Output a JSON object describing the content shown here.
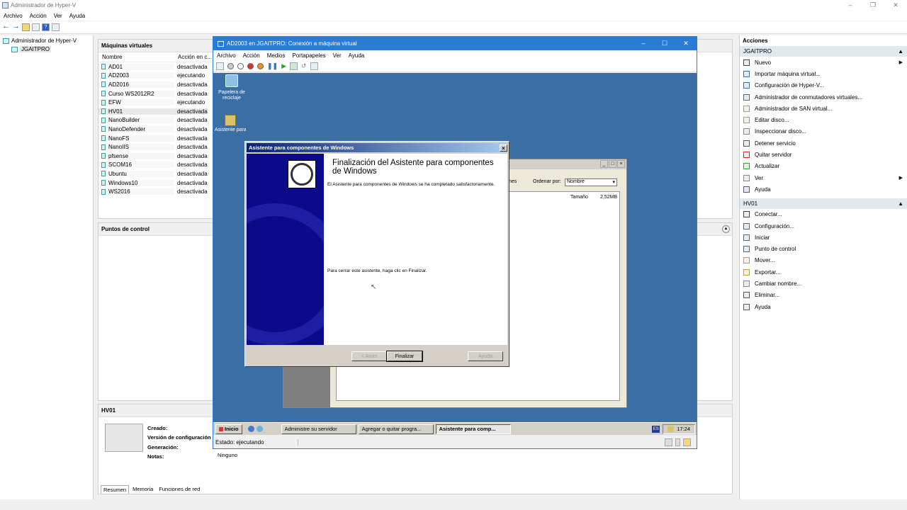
{
  "app": {
    "title": "Administrador de Hyper-V"
  },
  "menu": [
    "Archivo",
    "Acción",
    "Ver",
    "Ayuda"
  ],
  "tree": {
    "root": "Administrador de Hyper-V",
    "server": "JGAITPRO"
  },
  "vms": {
    "title": "Máquinas virtuales",
    "col_name": "Nombre",
    "col_state": "Acción en c...",
    "rows": [
      {
        "name": "AD01",
        "state": "desactivada"
      },
      {
        "name": "AD2003",
        "state": "ejecutando"
      },
      {
        "name": "AD2016",
        "state": "desactivada"
      },
      {
        "name": "Curso WS2012R2",
        "state": "desactivada"
      },
      {
        "name": "EFW",
        "state": "ejecutando"
      },
      {
        "name": "HV01",
        "state": "desactivada"
      },
      {
        "name": "NanoBuilder",
        "state": "desactivada"
      },
      {
        "name": "NanoDefender",
        "state": "desactivada"
      },
      {
        "name": "NanoFS",
        "state": "desactivada"
      },
      {
        "name": "NanoIIS",
        "state": "desactivada"
      },
      {
        "name": "pfsense",
        "state": "desactivada"
      },
      {
        "name": "SCOM16",
        "state": "desactivada"
      },
      {
        "name": "Ubuntu",
        "state": "desactivada"
      },
      {
        "name": "Windows10",
        "state": "desactivada"
      },
      {
        "name": "WS2016",
        "state": "desactivada"
      }
    ]
  },
  "checkpoints": {
    "title": "Puntos de control"
  },
  "details": {
    "title": "HV01",
    "created": "Creado:",
    "version": "Versión de configuración",
    "generation": "Generación:",
    "notes": "Notas:",
    "notes_value": "Ninguno",
    "tabs": [
      "Resumen",
      "Memoria",
      "Funciones de red"
    ]
  },
  "actions": {
    "title": "Acciones",
    "server_group": "JGAITPRO",
    "server_items": [
      "Nuevo",
      "Importar máquina virtual...",
      "Configuración de Hyper-V...",
      "Administrador de conmutadores virtuales...",
      "Administrador de SAN virtual...",
      "Editar disco...",
      "Inspeccionar disco...",
      "Detener servicio",
      "Quitar servidor",
      "Actualizar",
      "Ver",
      "Ayuda"
    ],
    "vm_group": "HV01",
    "vm_items": [
      "Conectar...",
      "Configuración...",
      "Iniciar",
      "Punto de control",
      "Mover...",
      "Exportar...",
      "Cambiar nombre...",
      "Eliminar...",
      "Ayuda"
    ]
  },
  "vmconn": {
    "title": "AD2003 en JGAITPRO: Conexión a máquina virtual",
    "menu": [
      "Archivo",
      "Acción",
      "Medios",
      "Portapapeles",
      "Ver",
      "Ayuda"
    ],
    "status": "Estado: ejecutando"
  },
  "guest": {
    "icon_recycle": "Papelera de reciclaje",
    "icon_wizard": "Asistente para configuració...",
    "bg_sort_label": "Ordenar por:",
    "bg_sort_value": "Nombre",
    "bg_partial": "nes",
    "bg_size_label": "Tamaño",
    "bg_size_value": "2,52MB",
    "taskbar": {
      "start": "Inicio",
      "tasks": [
        "Administre su servidor",
        "Agregar o quitar progra...",
        "Asistente para comp..."
      ],
      "lang": "ES",
      "clock": "17:24"
    }
  },
  "wizard": {
    "title": "Asistente para componentes de Windows",
    "heading": "Finalización del Asistente para componentes de Windows",
    "message": "El Asistente para componentes de Windows se ha completado satisfactoriamente.",
    "close_hint": "Para cerrar este asistente, haga clic en Finalizar.",
    "back": "< Atrás",
    "finish": "Finalizar",
    "help": "Ayuda"
  }
}
